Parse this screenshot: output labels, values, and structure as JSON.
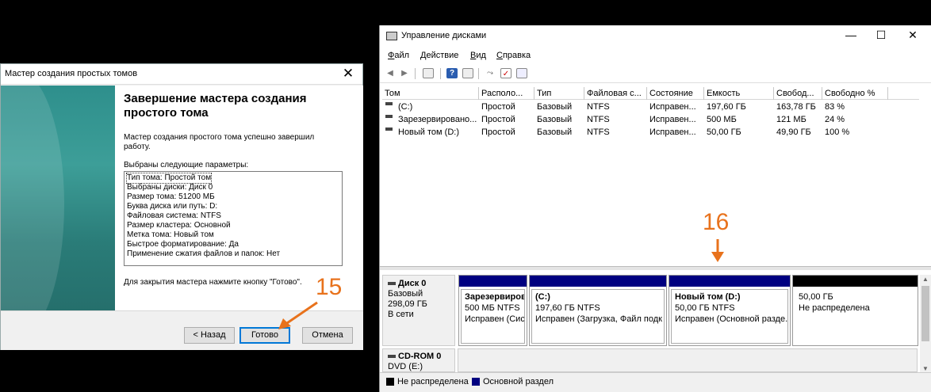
{
  "wizard": {
    "title": "Мастер создания простых томов",
    "heading": "Завершение мастера создания простого тома",
    "description": "Мастер создания простого тома успешно завершил работу.",
    "params_label": "Выбраны следующие параметры:",
    "params": [
      "Тип тома: Простой том",
      "Выбраны диски: Диск 0",
      "Размер тома: 51200 МБ",
      "Буква диска или путь: D:",
      "Файловая система: NTFS",
      "Размер кластера: Основной",
      "Метка тома: Новый том",
      "Быстрое форматирование: Да",
      "Применение сжатия файлов и папок: Нет"
    ],
    "hint": "Для закрытия мастера нажмите кнопку \"Готово\".",
    "buttons": {
      "back": "< Назад",
      "finish": "Готово",
      "cancel": "Отмена"
    },
    "close_glyph": "✕"
  },
  "disk_mgmt": {
    "title": "Управление дисками",
    "controls": {
      "minimize": "—",
      "maximize": "☐",
      "close": "✕"
    },
    "menu": [
      "Файл",
      "Действие",
      "Вид",
      "Справка"
    ],
    "columns": [
      "Том",
      "Располо...",
      "Тип",
      "Файловая с...",
      "Состояние",
      "Емкость",
      "Свобод...",
      "Свободно %"
    ],
    "volumes": [
      [
        "(C:)",
        "Простой",
        "Базовый",
        "NTFS",
        "Исправен...",
        "197,60 ГБ",
        "163,78 ГБ",
        "83 %"
      ],
      [
        "Зарезервировано...",
        "Простой",
        "Базовый",
        "NTFS",
        "Исправен...",
        "500 МБ",
        "121 МБ",
        "24 %"
      ],
      [
        "Новый том (D:)",
        "Простой",
        "Базовый",
        "NTFS",
        "Исправен...",
        "50,00 ГБ",
        "49,90 ГБ",
        "100 %"
      ]
    ],
    "disk0": {
      "name": "Диск 0",
      "type": "Базовый",
      "size": "298,09 ГБ",
      "status": "В сети",
      "partitions": [
        {
          "title": "Зарезервиров",
          "size": "500 МБ NTFS",
          "status": "Исправен (Сис"
        },
        {
          "title": "(C:)",
          "size": "197,60 ГБ NTFS",
          "status": "Исправен (Загрузка, Файл подк"
        },
        {
          "title": "Новый том  (D:)",
          "size": "50,00 ГБ NTFS",
          "status": "Исправен (Основной разде."
        },
        {
          "title": "",
          "size": "50,00 ГБ",
          "status": "Не распределена"
        }
      ]
    },
    "cdrom": {
      "name": "CD-ROM 0",
      "type": "DVD (E:)"
    },
    "legend": [
      {
        "label": "Не распределена",
        "color": "#000000"
      },
      {
        "label": "Основной раздел",
        "color": "#000080"
      }
    ],
    "colors": {
      "primary_partition": "#000080",
      "unallocated": "#000000"
    }
  },
  "annotations": {
    "step15": "15",
    "step16": "16"
  }
}
